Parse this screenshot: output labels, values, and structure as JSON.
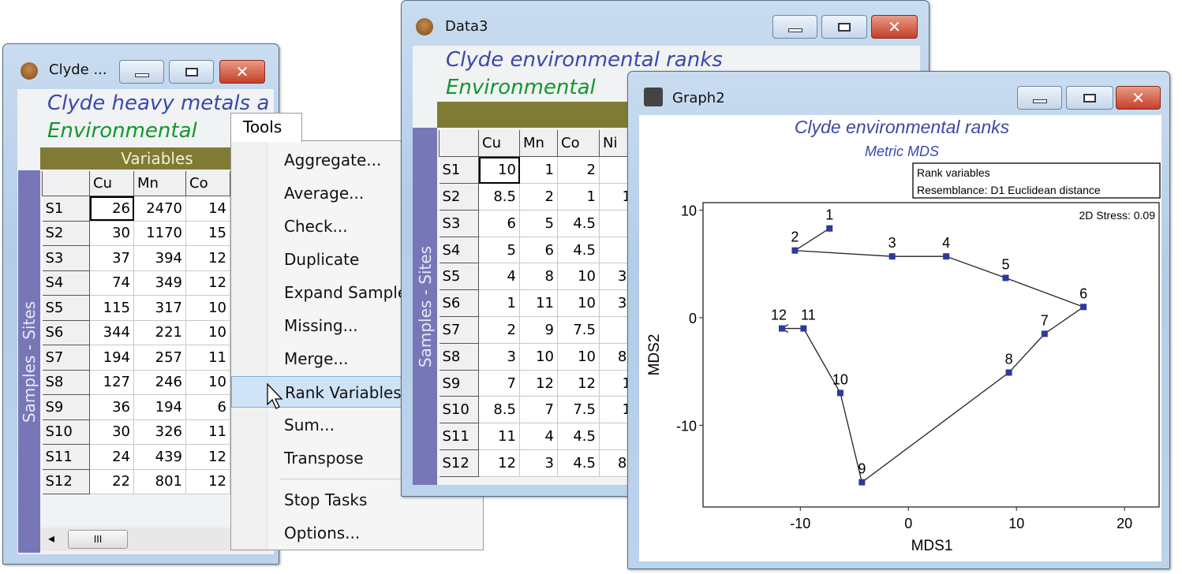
{
  "window1": {
    "title": "Clyde ...",
    "header_title": "Clyde heavy metals a",
    "header_type": "Environmental",
    "variables_label": "Variables",
    "samples_label": "Samples - Sites",
    "columns": [
      "Cu",
      "Mn",
      "Co"
    ],
    "rows": [
      [
        "S1",
        "26",
        "2470",
        "14"
      ],
      [
        "S2",
        "30",
        "1170",
        "15"
      ],
      [
        "S3",
        "37",
        "394",
        "12"
      ],
      [
        "S4",
        "74",
        "349",
        "12"
      ],
      [
        "S5",
        "115",
        "317",
        "10"
      ],
      [
        "S6",
        "344",
        "221",
        "10"
      ],
      [
        "S7",
        "194",
        "257",
        "11"
      ],
      [
        "S8",
        "127",
        "246",
        "10"
      ],
      [
        "S9",
        "36",
        "194",
        "6"
      ],
      [
        "S10",
        "30",
        "326",
        "11"
      ],
      [
        "S11",
        "24",
        "439",
        "12"
      ],
      [
        "S12",
        "22",
        "801",
        "12"
      ]
    ],
    "scroll_left": "◂",
    "scroll_thumb": "III"
  },
  "menu": {
    "title": "Tools",
    "items": [
      "Aggregate...",
      "Average...",
      "Check...",
      "Duplicate",
      "Expand Sample",
      "Missing...",
      "Merge...",
      "Rank Variables",
      "Sum...",
      "Transpose"
    ],
    "items2": [
      "Stop Tasks",
      "Options..."
    ],
    "highlighted": "Rank Variables"
  },
  "window2": {
    "title": "Data3",
    "header_title": "Clyde environmental ranks",
    "header_type": "Environmental",
    "samples_label": "Samples - Sites",
    "columns": [
      "Cu",
      "Mn",
      "Co",
      "Ni"
    ],
    "rows": [
      [
        "S1",
        "10",
        "1",
        "2",
        ""
      ],
      [
        "S2",
        "8.5",
        "2",
        "1",
        "1"
      ],
      [
        "S3",
        "6",
        "5",
        "4.5",
        ""
      ],
      [
        "S4",
        "5",
        "6",
        "4.5",
        ""
      ],
      [
        "S5",
        "4",
        "8",
        "10",
        "3."
      ],
      [
        "S6",
        "1",
        "11",
        "10",
        "3."
      ],
      [
        "S7",
        "2",
        "9",
        "7.5",
        ""
      ],
      [
        "S8",
        "3",
        "10",
        "10",
        "8."
      ],
      [
        "S9",
        "7",
        "12",
        "12",
        "1"
      ],
      [
        "S10",
        "8.5",
        "7",
        "7.5",
        "1"
      ],
      [
        "S11",
        "11",
        "4",
        "4.5",
        ""
      ],
      [
        "S12",
        "12",
        "3",
        "4.5",
        "8."
      ]
    ]
  },
  "window3": {
    "title": "Graph2"
  },
  "chart_data": {
    "type": "scatter",
    "title": "Clyde environmental ranks",
    "subtitle": "Metric MDS",
    "legend_lines": [
      "Rank variables",
      "Resemblance: D1 Euclidean distance"
    ],
    "stress": "2D Stress: 0.09",
    "xlabel": "MDS1",
    "ylabel": "MDS2",
    "xticks": [
      -10,
      0,
      10,
      20
    ],
    "yticks": [
      10,
      0,
      -10
    ],
    "xlim": [
      -19,
      23.2
    ],
    "ylim": [
      -17.6,
      10.7
    ],
    "trajectory": true,
    "marker_color": "#2b3a9c",
    "points": [
      {
        "label": "1",
        "x": -7.3,
        "y": 8.3
      },
      {
        "label": "2",
        "x": -10.5,
        "y": 6.25
      },
      {
        "label": "3",
        "x": -1.5,
        "y": 5.7
      },
      {
        "label": "4",
        "x": 3.5,
        "y": 5.7
      },
      {
        "label": "5",
        "x": 9.0,
        "y": 3.7
      },
      {
        "label": "6",
        "x": 16.2,
        "y": 1.0
      },
      {
        "label": "7",
        "x": 12.6,
        "y": -1.5
      },
      {
        "label": "8",
        "x": 9.3,
        "y": -5.1
      },
      {
        "label": "9",
        "x": -4.3,
        "y": -15.3
      },
      {
        "label": "10",
        "x": -6.3,
        "y": -7.0
      },
      {
        "label": "11",
        "x": -9.7,
        "y": -1.0
      },
      {
        "label": "12",
        "x": -11.7,
        "y": -1.0
      }
    ]
  }
}
